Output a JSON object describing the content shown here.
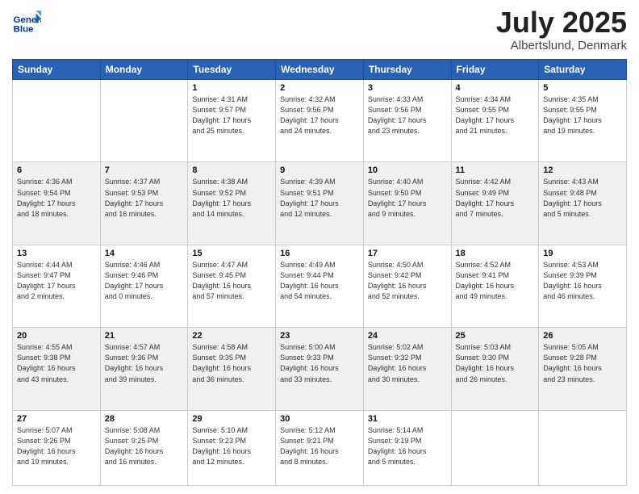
{
  "header": {
    "logo_line1": "General",
    "logo_line2": "Blue",
    "month": "July 2025",
    "location": "Albertslund, Denmark"
  },
  "weekdays": [
    "Sunday",
    "Monday",
    "Tuesday",
    "Wednesday",
    "Thursday",
    "Friday",
    "Saturday"
  ],
  "weeks": [
    [
      {
        "day": "",
        "detail": ""
      },
      {
        "day": "",
        "detail": ""
      },
      {
        "day": "1",
        "detail": "Sunrise: 4:31 AM\nSunset: 9:57 PM\nDaylight: 17 hours\nand 25 minutes."
      },
      {
        "day": "2",
        "detail": "Sunrise: 4:32 AM\nSunset: 9:56 PM\nDaylight: 17 hours\nand 24 minutes."
      },
      {
        "day": "3",
        "detail": "Sunrise: 4:33 AM\nSunset: 9:56 PM\nDaylight: 17 hours\nand 23 minutes."
      },
      {
        "day": "4",
        "detail": "Sunrise: 4:34 AM\nSunset: 9:55 PM\nDaylight: 17 hours\nand 21 minutes."
      },
      {
        "day": "5",
        "detail": "Sunrise: 4:35 AM\nSunset: 9:55 PM\nDaylight: 17 hours\nand 19 minutes."
      }
    ],
    [
      {
        "day": "6",
        "detail": "Sunrise: 4:36 AM\nSunset: 9:54 PM\nDaylight: 17 hours\nand 18 minutes."
      },
      {
        "day": "7",
        "detail": "Sunrise: 4:37 AM\nSunset: 9:53 PM\nDaylight: 17 hours\nand 16 minutes."
      },
      {
        "day": "8",
        "detail": "Sunrise: 4:38 AM\nSunset: 9:52 PM\nDaylight: 17 hours\nand 14 minutes."
      },
      {
        "day": "9",
        "detail": "Sunrise: 4:39 AM\nSunset: 9:51 PM\nDaylight: 17 hours\nand 12 minutes."
      },
      {
        "day": "10",
        "detail": "Sunrise: 4:40 AM\nSunset: 9:50 PM\nDaylight: 17 hours\nand 9 minutes."
      },
      {
        "day": "11",
        "detail": "Sunrise: 4:42 AM\nSunset: 9:49 PM\nDaylight: 17 hours\nand 7 minutes."
      },
      {
        "day": "12",
        "detail": "Sunrise: 4:43 AM\nSunset: 9:48 PM\nDaylight: 17 hours\nand 5 minutes."
      }
    ],
    [
      {
        "day": "13",
        "detail": "Sunrise: 4:44 AM\nSunset: 9:47 PM\nDaylight: 17 hours\nand 2 minutes."
      },
      {
        "day": "14",
        "detail": "Sunrise: 4:46 AM\nSunset: 9:46 PM\nDaylight: 17 hours\nand 0 minutes."
      },
      {
        "day": "15",
        "detail": "Sunrise: 4:47 AM\nSunset: 9:45 PM\nDaylight: 16 hours\nand 57 minutes."
      },
      {
        "day": "16",
        "detail": "Sunrise: 4:49 AM\nSunset: 9:44 PM\nDaylight: 16 hours\nand 54 minutes."
      },
      {
        "day": "17",
        "detail": "Sunrise: 4:50 AM\nSunset: 9:42 PM\nDaylight: 16 hours\nand 52 minutes."
      },
      {
        "day": "18",
        "detail": "Sunrise: 4:52 AM\nSunset: 9:41 PM\nDaylight: 16 hours\nand 49 minutes."
      },
      {
        "day": "19",
        "detail": "Sunrise: 4:53 AM\nSunset: 9:39 PM\nDaylight: 16 hours\nand 46 minutes."
      }
    ],
    [
      {
        "day": "20",
        "detail": "Sunrise: 4:55 AM\nSunset: 9:38 PM\nDaylight: 16 hours\nand 43 minutes."
      },
      {
        "day": "21",
        "detail": "Sunrise: 4:57 AM\nSunset: 9:36 PM\nDaylight: 16 hours\nand 39 minutes."
      },
      {
        "day": "22",
        "detail": "Sunrise: 4:58 AM\nSunset: 9:35 PM\nDaylight: 16 hours\nand 36 minutes."
      },
      {
        "day": "23",
        "detail": "Sunrise: 5:00 AM\nSunset: 9:33 PM\nDaylight: 16 hours\nand 33 minutes."
      },
      {
        "day": "24",
        "detail": "Sunrise: 5:02 AM\nSunset: 9:32 PM\nDaylight: 16 hours\nand 30 minutes."
      },
      {
        "day": "25",
        "detail": "Sunrise: 5:03 AM\nSunset: 9:30 PM\nDaylight: 16 hours\nand 26 minutes."
      },
      {
        "day": "26",
        "detail": "Sunrise: 5:05 AM\nSunset: 9:28 PM\nDaylight: 16 hours\nand 23 minutes."
      }
    ],
    [
      {
        "day": "27",
        "detail": "Sunrise: 5:07 AM\nSunset: 9:26 PM\nDaylight: 16 hours\nand 19 minutes."
      },
      {
        "day": "28",
        "detail": "Sunrise: 5:08 AM\nSunset: 9:25 PM\nDaylight: 16 hours\nand 16 minutes."
      },
      {
        "day": "29",
        "detail": "Sunrise: 5:10 AM\nSunset: 9:23 PM\nDaylight: 16 hours\nand 12 minutes."
      },
      {
        "day": "30",
        "detail": "Sunrise: 5:12 AM\nSunset: 9:21 PM\nDaylight: 16 hours\nand 8 minutes."
      },
      {
        "day": "31",
        "detail": "Sunrise: 5:14 AM\nSunset: 9:19 PM\nDaylight: 16 hours\nand 5 minutes."
      },
      {
        "day": "",
        "detail": ""
      },
      {
        "day": "",
        "detail": ""
      }
    ]
  ]
}
